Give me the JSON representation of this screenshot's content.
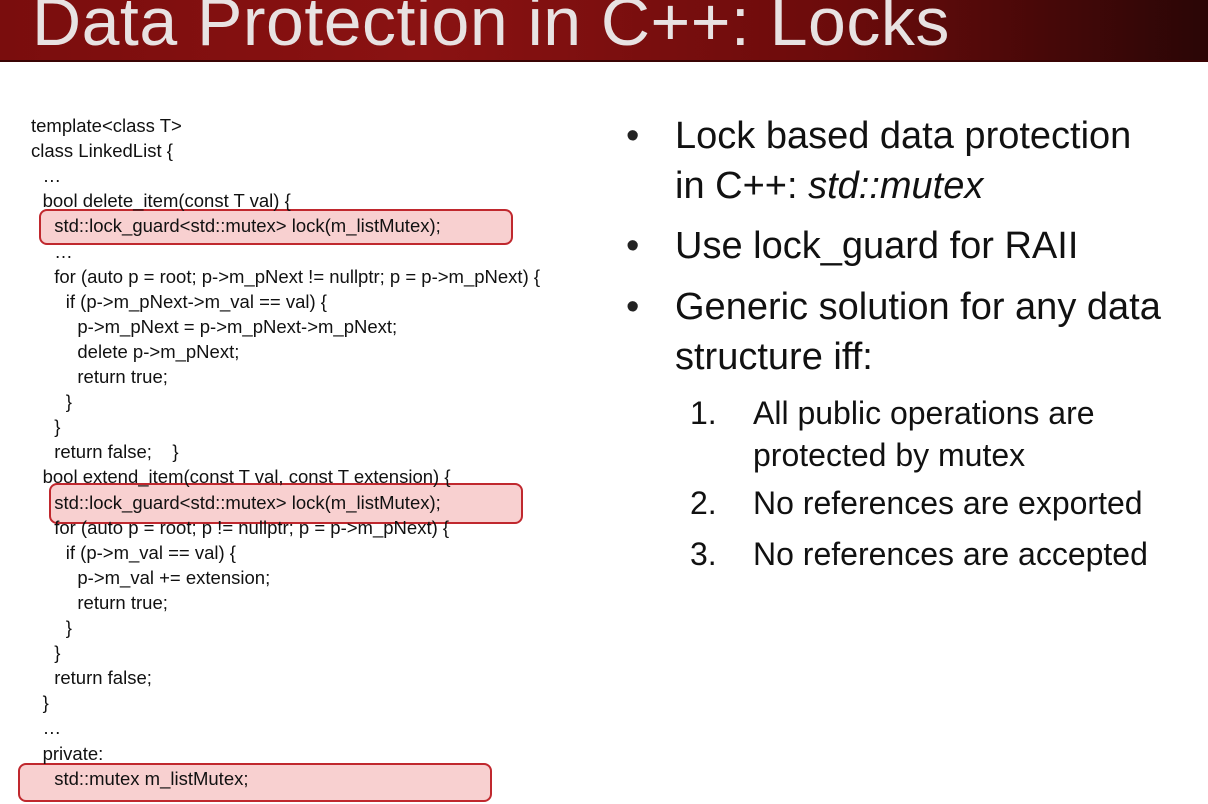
{
  "title": "Data Protection in C++: Locks",
  "code_lines": [
    "template<class T>",
    "class LinkedList {",
    "  …",
    "  bool delete_item(const T val) {",
    "    std::lock_guard<std::mutex> lock(m_listMutex);",
    "    …",
    "    for (auto p = root; p->m_pNext != nullptr; p = p->m_pNext) {",
    "      if (p->m_pNext->m_val == val) {",
    "        p->m_pNext = p->m_pNext->m_pNext;",
    "        delete p->m_pNext;",
    "        return true;",
    "      }",
    "    }",
    "    return false;    }",
    "  bool extend_item(const T val, const T extension) {",
    "    std::lock_guard<std::mutex> lock(m_listMutex);",
    "    for (auto p = root; p != nullptr; p = p->m_pNext) {",
    "      if (p->m_val == val) {",
    "        p->m_val += extension;",
    "        return true;",
    "      }",
    "    }",
    "    return false;",
    "  }",
    "  …",
    "  private:",
    "    std::mutex m_listMutex;"
  ],
  "bullets": {
    "b1_line1": "Lock based data protection",
    "b1_line2_prefix": "in C++: ",
    "b1_line2_italic": "std::mutex",
    "b2": "Use lock_guard for RAII",
    "b3_line1": "Generic solution for any data",
    "b3_line2": "structure iff:",
    "bullet_char": "•"
  },
  "numbered": [
    {
      "num": "1.",
      "line1": "All public operations are",
      "line2": "protected by mutex"
    },
    {
      "num": "2.",
      "line1": "No references are exported",
      "line2": ""
    },
    {
      "num": "3.",
      "line1": "No references are accepted",
      "line2": ""
    }
  ]
}
